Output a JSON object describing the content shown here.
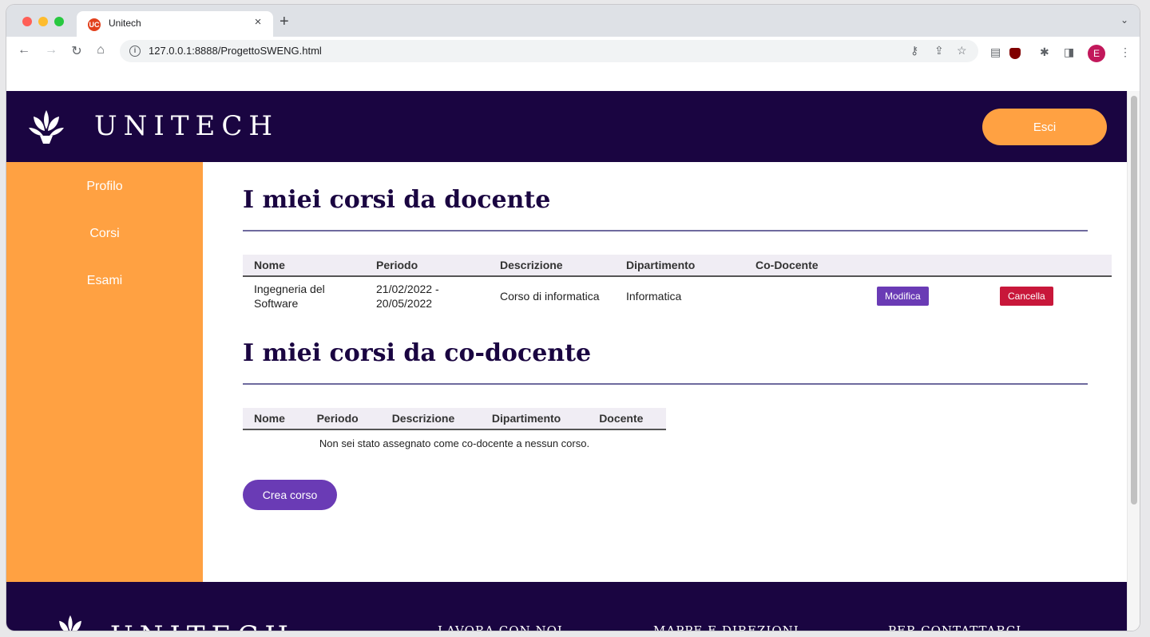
{
  "browser": {
    "tab_title": "Unitech",
    "tab_favicon": "UC",
    "tab_close": "×",
    "new_tab": "+",
    "tab_menu": "⌄",
    "url": "127.0.0.1:8888/ProgettoSWENG.html",
    "info": "i",
    "profile_initial": "E"
  },
  "header": {
    "brand": "UNITECH",
    "logout_label": "Esci"
  },
  "sidebar": {
    "items": [
      {
        "label": "Profilo"
      },
      {
        "label": "Corsi"
      },
      {
        "label": "Esami"
      }
    ]
  },
  "teacher_section": {
    "title": "I miei corsi da docente",
    "columns": [
      "Nome",
      "Periodo",
      "Descrizione",
      "Dipartimento",
      "Co-Docente"
    ],
    "rows": [
      {
        "nome": "Ingegneria del Software",
        "periodo": "21/02/2022 - 20/05/2022",
        "descrizione": "Corso di informatica",
        "dipartimento": "Informatica",
        "codocente": "",
        "edit_label": "Modifica",
        "delete_label": "Cancella"
      }
    ]
  },
  "codocente_section": {
    "title": "I miei corsi da co-docente",
    "columns": [
      "Nome",
      "Periodo",
      "Descrizione",
      "Dipartimento",
      "Docente"
    ],
    "empty_message": "Non sei stato assegnato come co-docente a nessun corso."
  },
  "create_course_label": "Crea corso",
  "footer": {
    "brand": "UNITECH",
    "links": [
      "LAVORA CON NOI",
      "MAPPE E DIREZIONI",
      "PER CONTATTARCI"
    ]
  },
  "colors": {
    "primary_dark": "#1a0541",
    "accent_orange": "#ffa142",
    "button_purple": "#6a3bb5",
    "button_red": "#c8173a"
  }
}
